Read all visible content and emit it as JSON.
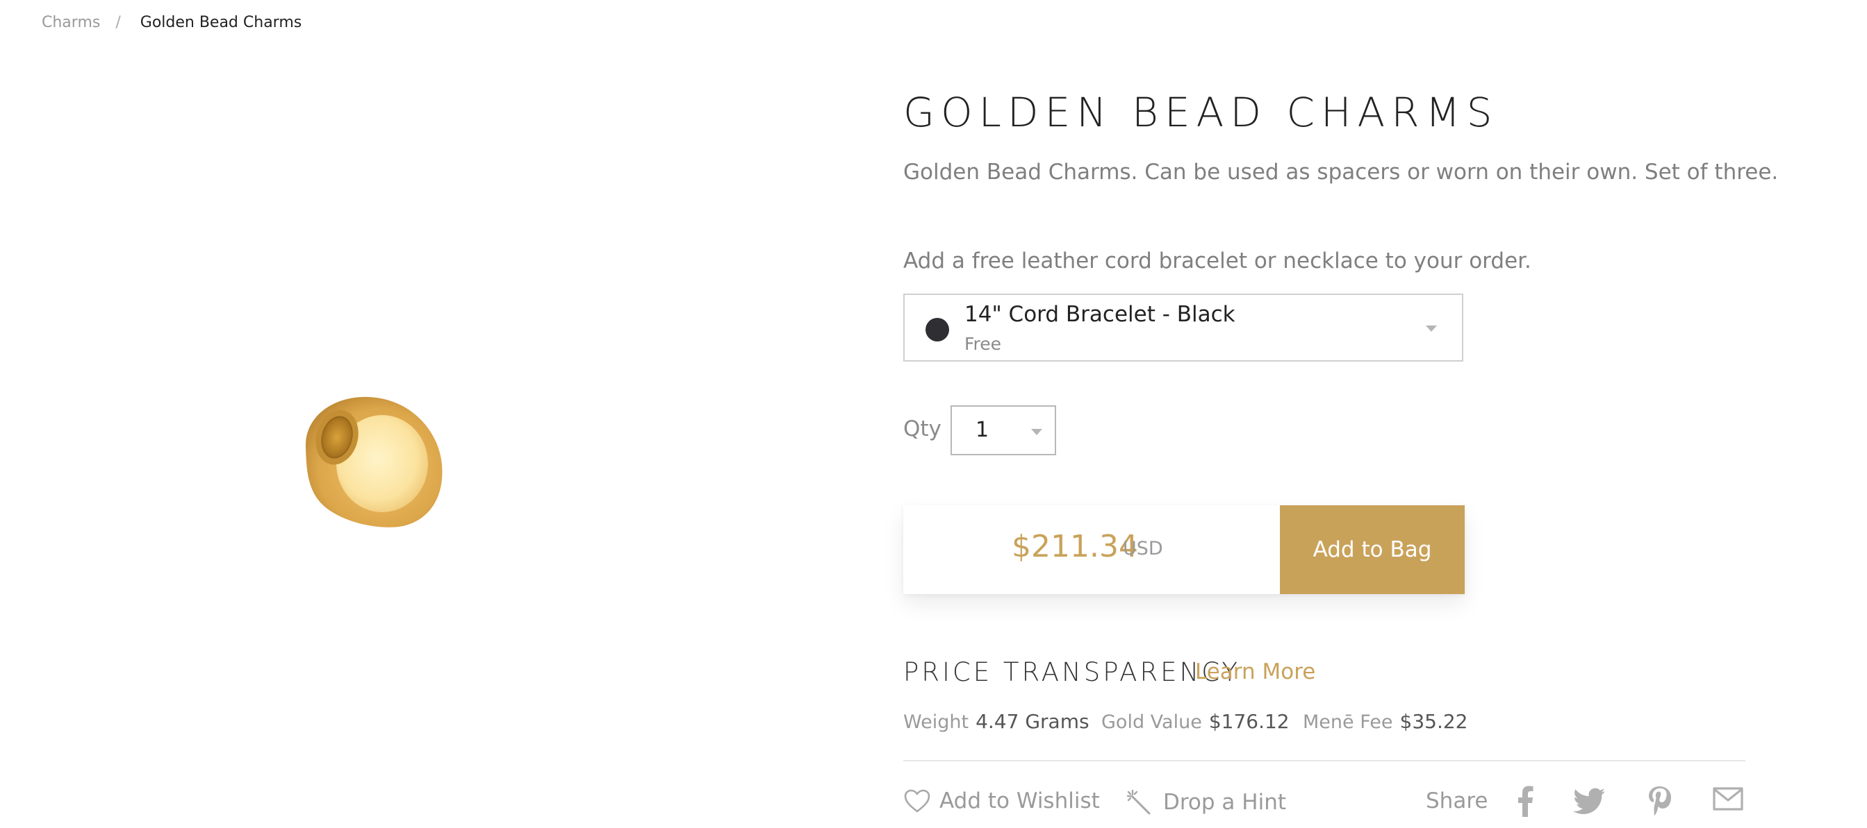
{
  "breadcrumb": {
    "parent": "Charms",
    "separator": "/",
    "current": "Golden Bead Charms"
  },
  "product": {
    "title": "GOLDEN BEAD CHARMS",
    "description": "Golden Bead Charms. Can be used as spacers or worn on their own. Set of three.",
    "image_icon": "golden-bead-charm"
  },
  "addon": {
    "prompt": "Add a free leather cord bracelet or necklace to your order.",
    "selected_name": "14\" Cord Bracelet - Black",
    "selected_price": "Free",
    "swatch_color": "#2e2e33"
  },
  "quantity": {
    "label": "Qty",
    "value": "1"
  },
  "purchase": {
    "price": "$211.34",
    "currency": "USD",
    "button_label": "Add to Bag",
    "accent_color": "#c9a25a"
  },
  "transparency": {
    "title": "PRICE TRANSPARENCY",
    "learn_more": "Learn More",
    "weight_label": "Weight",
    "weight_value": "4.47 Grams",
    "gold_label": "Gold Value",
    "gold_value": "$176.12",
    "fee_label": "Menē Fee",
    "fee_value": "$35.22"
  },
  "actions": {
    "wishlist": "Add to Wishlist",
    "hint": "Drop a Hint",
    "share": "Share",
    "social_icons": [
      "facebook-icon",
      "twitter-icon",
      "pinterest-icon",
      "email-icon"
    ]
  }
}
